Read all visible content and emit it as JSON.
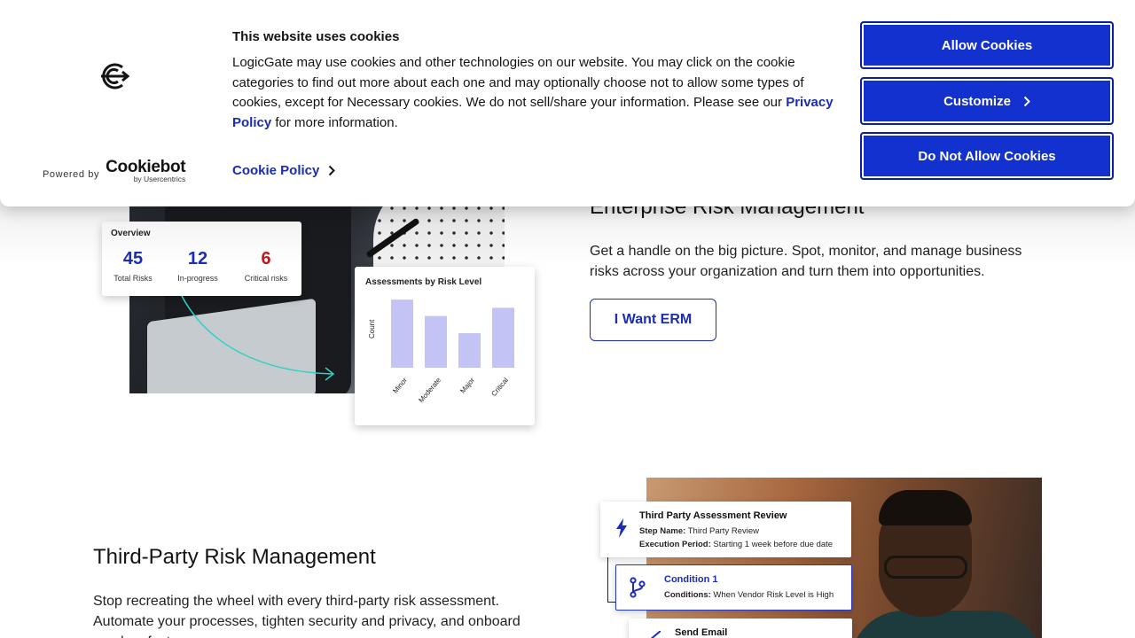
{
  "cookie_banner": {
    "title": "This website uses cookies",
    "body_prefix": "LogicGate may use cookies and other technologies on our website. You may click on the cookie categories to find out more about each one and may optionally choose not to allow some types of cookies, except for Necessary cookies.  We do not sell/share your information. Please see our ",
    "privacy_link": "Privacy Policy",
    "body_suffix": " for more information.",
    "cookie_policy_link": "Cookie Policy",
    "powered_by": "Powered by",
    "cookiebot_name": "Cookiebot",
    "cookiebot_sub": "by Usercentrics",
    "buttons": {
      "allow": "Allow Cookies",
      "customize": "Customize",
      "deny": "Do Not Allow Cookies"
    },
    "colors": {
      "button_bg": "#1331cf",
      "link": "#1a2db5"
    }
  },
  "erm_section": {
    "title": "Enterprise Risk Management",
    "description": "Get a handle on the big picture. Spot, monitor, and manage business risks across your organization and turn them into opportunities.",
    "cta": "I Want ERM",
    "overview_card": {
      "title": "Overview",
      "stats": [
        {
          "value": "45",
          "label": "Total Risks"
        },
        {
          "value": "12",
          "label": "In-progress"
        },
        {
          "value": "6",
          "label": "Critical risks"
        }
      ]
    },
    "assessment_card": {
      "title": "Assessments by Risk Level",
      "ylabel": "Count"
    }
  },
  "chart_data": {
    "type": "bar",
    "title": "Assessments by Risk Level",
    "xlabel": "",
    "ylabel": "Count",
    "categories": [
      "Minor",
      "Moderate",
      "Major",
      "Critical"
    ],
    "values": [
      75,
      57,
      38,
      66
    ],
    "ylim": [
      0,
      80
    ],
    "grid": false,
    "bar_color": "#c3c3f5"
  },
  "tprm_section": {
    "title": "Third-Party Risk Management",
    "description": "Stop recreating the wheel with every third-party risk assessment. Automate your processes, tighten security and privacy, and onboard vendors faster.",
    "workflow": {
      "step1": {
        "title": "Third Party Assessment Review",
        "line1_label": "Step Name:",
        "line1_value": " Third Party Review",
        "line2_label": "Execution Period:",
        "line2_value": " Starting 1 week before due date"
      },
      "step2": {
        "title": "Condition 1",
        "line1_label": "Conditions:",
        "line1_value": " When Vendor Risk Level is High"
      },
      "step3": {
        "title": "Send Email"
      }
    }
  }
}
